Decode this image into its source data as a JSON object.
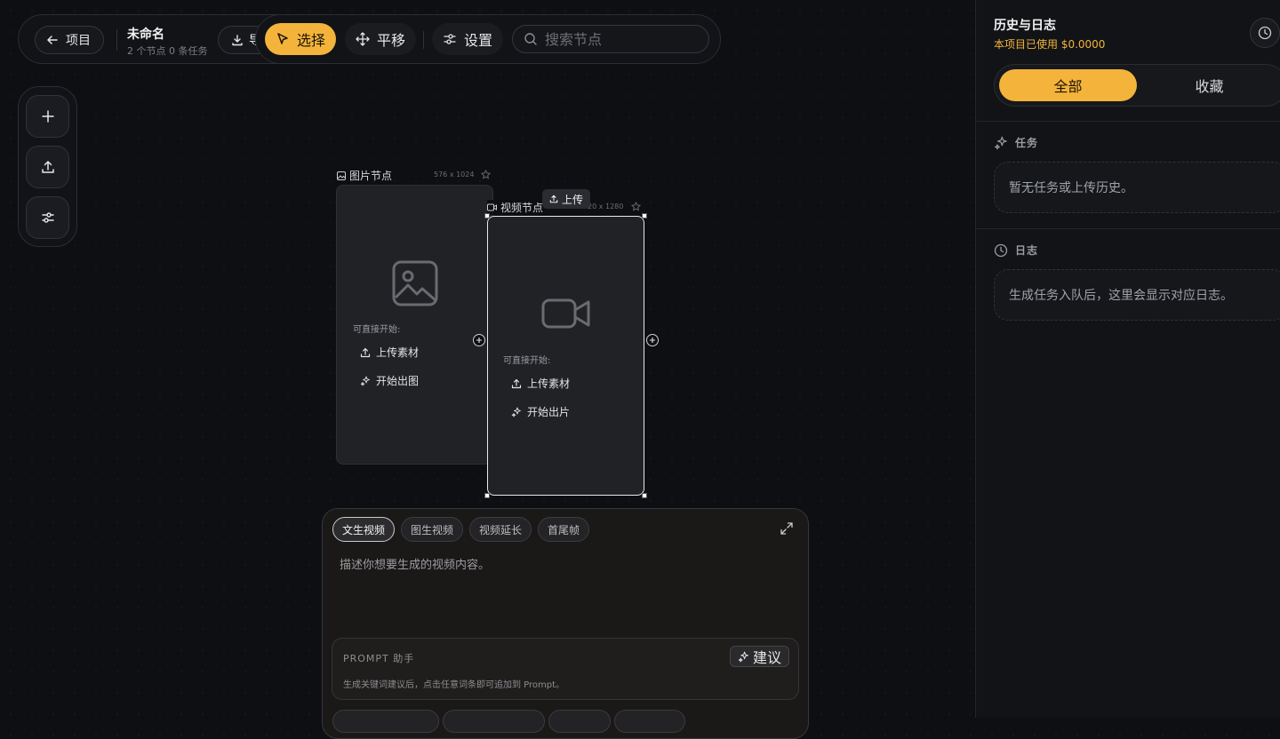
{
  "header": {
    "back_label": "项目",
    "project_title": "未命名",
    "project_stats": "2 个节点 0 条任务",
    "export_label": "导"
  },
  "toolbar": {
    "select_label": "选择",
    "pan_label": "平移",
    "settings_label": "设置",
    "search_placeholder": "搜索节点"
  },
  "left_tools": [
    "plus-icon",
    "upload-icon",
    "sliders-icon"
  ],
  "nodes": {
    "image": {
      "label": "图片节点",
      "size": "576 x 1024",
      "hint": "可直接开始:",
      "upload_label": "上传素材",
      "generate_label": "开始出图"
    },
    "video": {
      "label": "视频节点",
      "size": "720 x 1280",
      "size_visible": "20 x 1280",
      "hint": "可直接开始:",
      "upload_label": "上传素材",
      "generate_label": "开始出片",
      "upload_tag": "上传"
    }
  },
  "prompt_panel": {
    "tabs": [
      {
        "label": "文生视频",
        "active": true
      },
      {
        "label": "图生视频",
        "active": false
      },
      {
        "label": "视频延长",
        "active": false
      },
      {
        "label": "首尾帧",
        "active": false
      }
    ],
    "placeholder": "描述你想要生成的视频内容。",
    "assistant_title": "PROMPT 助手",
    "assistant_desc": "生成关键词建议后，点击任意词条即可追加到 Prompt。",
    "suggest_label": "建议"
  },
  "sidebar": {
    "title": "历史与日志",
    "cost": "本项目已使用 $0.0000",
    "tabs": [
      {
        "label": "全部",
        "active": true
      },
      {
        "label": "收藏",
        "active": false
      }
    ],
    "tasks_title": "任务",
    "tasks_empty": "暂无任务或上传历史。",
    "logs_title": "日志",
    "logs_empty": "生成任务入队后，这里会显示对应日志。"
  },
  "colors": {
    "accent": "#f4b43b",
    "background": "#0d0f12",
    "panel": "#111316"
  }
}
